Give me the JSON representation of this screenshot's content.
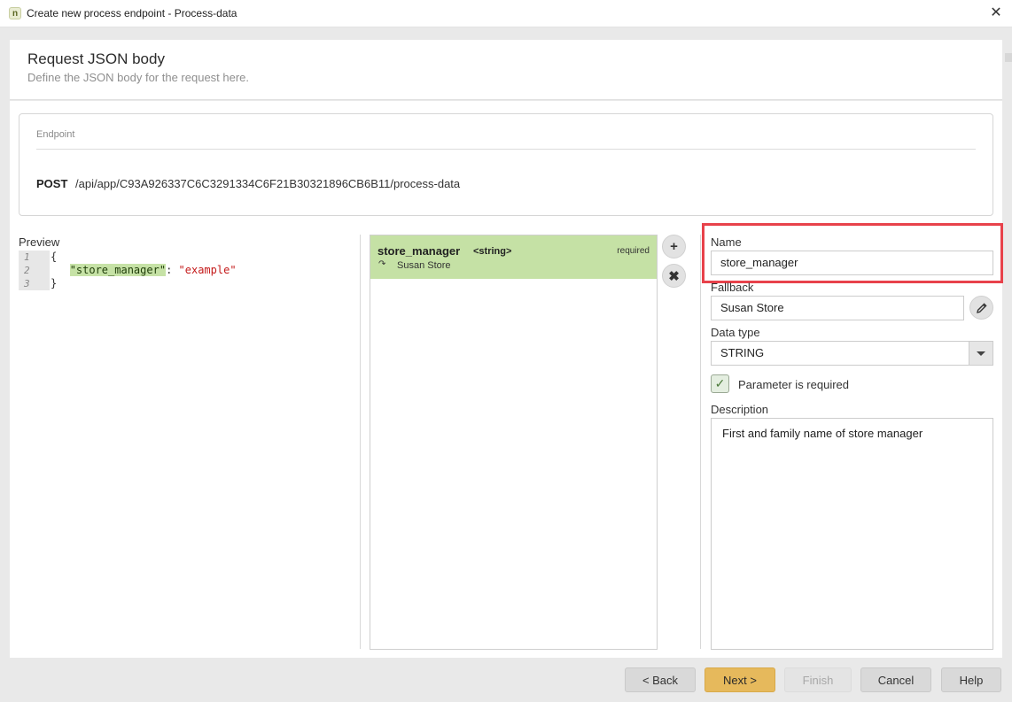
{
  "window": {
    "title": "Create new process endpoint - Process-data",
    "app_icon_glyph": "n"
  },
  "header": {
    "title": "Request JSON body",
    "subtitle": "Define the JSON body for the request here."
  },
  "endpoint": {
    "label": "Endpoint",
    "method": "POST",
    "path": "/api/app/C93A926337C6C3291334C6F21B30321896CB6B11/process-data"
  },
  "preview": {
    "label": "Preview",
    "lines": [
      {
        "num": "1",
        "text": "{"
      },
      {
        "num": "2",
        "key": "\"store_manager\"",
        "sep": ": ",
        "value": "\"example\""
      },
      {
        "num": "3",
        "text": "}"
      }
    ]
  },
  "parameters": [
    {
      "name": "store_manager",
      "type": "<string>",
      "required_label": "required",
      "fallback": "Susan Store",
      "selected": true
    }
  ],
  "editor": {
    "name_label": "Name",
    "name_value": "store_manager",
    "fallback_label": "Fallback",
    "fallback_value": "Susan Store",
    "datatype_label": "Data type",
    "datatype_value": "STRING",
    "required_label": "Parameter is required",
    "required_checked": true,
    "description_label": "Description",
    "description_value": "First and family name of store manager"
  },
  "footer": {
    "back": "< Back",
    "next": "Next >",
    "finish": "Finish",
    "cancel": "Cancel",
    "help": "Help"
  },
  "colors": {
    "accent_highlight": "#e8424b",
    "selected_row": "#c5e1a5",
    "next_button": "#e6b95c"
  }
}
